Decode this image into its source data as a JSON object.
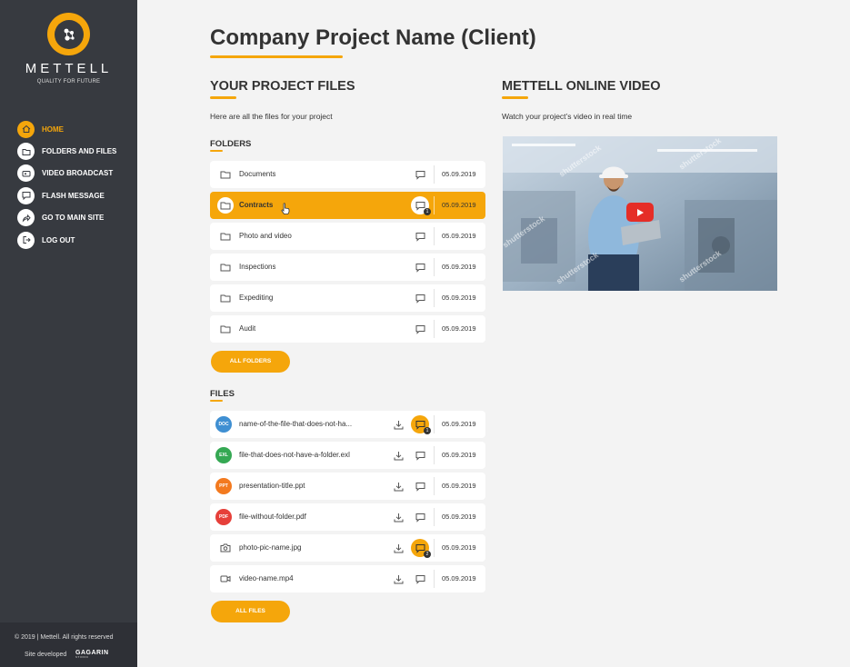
{
  "brand": {
    "name": "METTELL",
    "tagline": "QUALITY FOR FUTURE"
  },
  "nav": [
    {
      "label": "HOME",
      "icon": "home-icon"
    },
    {
      "label": "FOLDERS AND FILES",
      "icon": "folder-icon"
    },
    {
      "label": "VIDEO BROADCAST",
      "icon": "video-icon"
    },
    {
      "label": "FLASH MESSAGE",
      "icon": "message-icon"
    },
    {
      "label": "GO TO MAIN SITE",
      "icon": "share-icon"
    },
    {
      "label": "LOG OUT",
      "icon": "logout-icon"
    }
  ],
  "footer": {
    "copyright": "© 2019    |    Mettell. All rights reserved",
    "developed": "Site developed",
    "developer": "GAGARIN",
    "developer_sub": "STUDIO"
  },
  "page_title": "Company Project Name (Client)",
  "files_section": {
    "title": "YOUR PROJECT FILES",
    "description": "Here are all the files for your project",
    "folders_heading": "FOLDERS",
    "folders": [
      {
        "name": "Documents",
        "date": "05.09.2019"
      },
      {
        "name": "Contracts",
        "date": "05.09.2019",
        "count": "1"
      },
      {
        "name": "Photo and video",
        "date": "05.09.2019"
      },
      {
        "name": "Inspections",
        "date": "05.09.2019"
      },
      {
        "name": "Expediting",
        "date": "05.09.2019"
      },
      {
        "name": "Audit",
        "date": "05.09.2019"
      }
    ],
    "all_folders_label": "ALL FOLDERS",
    "files_heading": "FILES",
    "files": [
      {
        "badge": "DOC",
        "name": "name-of-the-file-that-does-not-ha...",
        "date": "05.09.2019",
        "count": "1"
      },
      {
        "badge": "EXL",
        "name": "file-that-does-not-have-a-folder.exl",
        "date": "05.09.2019"
      },
      {
        "badge": "PPT",
        "name": "presentation-title.ppt",
        "date": "05.09.2019"
      },
      {
        "badge": "PDF",
        "name": "file-without-folder.pdf",
        "date": "05.09.2019"
      },
      {
        "badge": "",
        "name": "photo-pic-name.jpg",
        "date": "05.09.2019",
        "count": "2"
      },
      {
        "badge": "",
        "name": "video-name.mp4",
        "date": "05.09.2019"
      }
    ],
    "all_files_label": "ALL FILES"
  },
  "video_section": {
    "title": "METTELL ONLINE VIDEO",
    "description": "Watch your project’s video in real time",
    "watermark": "shutterstock"
  },
  "colors": {
    "accent": "#f5a60b",
    "sidebar": "#373a40",
    "doc": "#3f8fd2",
    "exl": "#35a853",
    "ppt": "#f37a1f",
    "pdf": "#e6403a",
    "play": "#e52d27"
  }
}
